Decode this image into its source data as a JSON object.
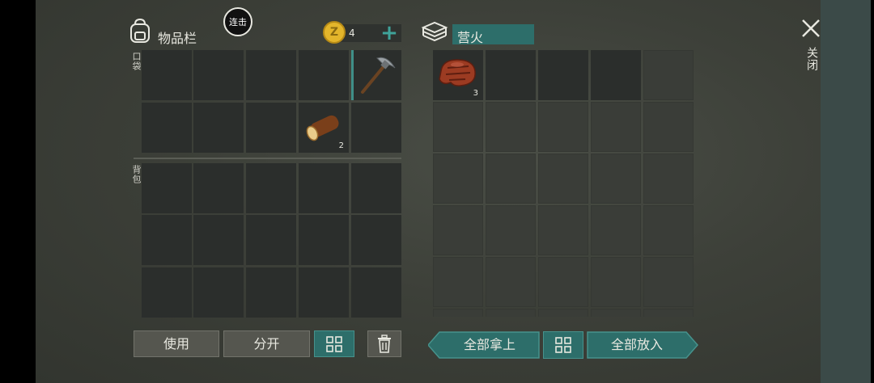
{
  "inventory": {
    "title": "物品栏",
    "combo_badge": "连击",
    "coins": {
      "count": "4",
      "coin_glyph": "Z",
      "add_label": "+"
    },
    "pocket_label": "口袋",
    "backpack_label": "背包",
    "pocket_slots": [
      {
        "item": null
      },
      {
        "item": null
      },
      {
        "item": null
      },
      {
        "item": null
      },
      {
        "item": "pickaxe",
        "count": "",
        "selected": true
      },
      {
        "item": null
      },
      {
        "item": null
      },
      {
        "item": null
      },
      {
        "item": "wood-log",
        "count": "2"
      },
      {
        "item": null
      }
    ],
    "use_button": "使用",
    "split_button": "分开"
  },
  "campfire": {
    "title": "营火",
    "slots_first": {
      "item": "steak",
      "count": "3"
    },
    "take_all_button": "全部拿上",
    "put_all_button": "全部放入"
  },
  "close": {
    "label": "关闭",
    "icon": "close-icon"
  },
  "colors": {
    "accent_teal": "#2d6e6a",
    "coin_gold": "#e3b52b"
  }
}
